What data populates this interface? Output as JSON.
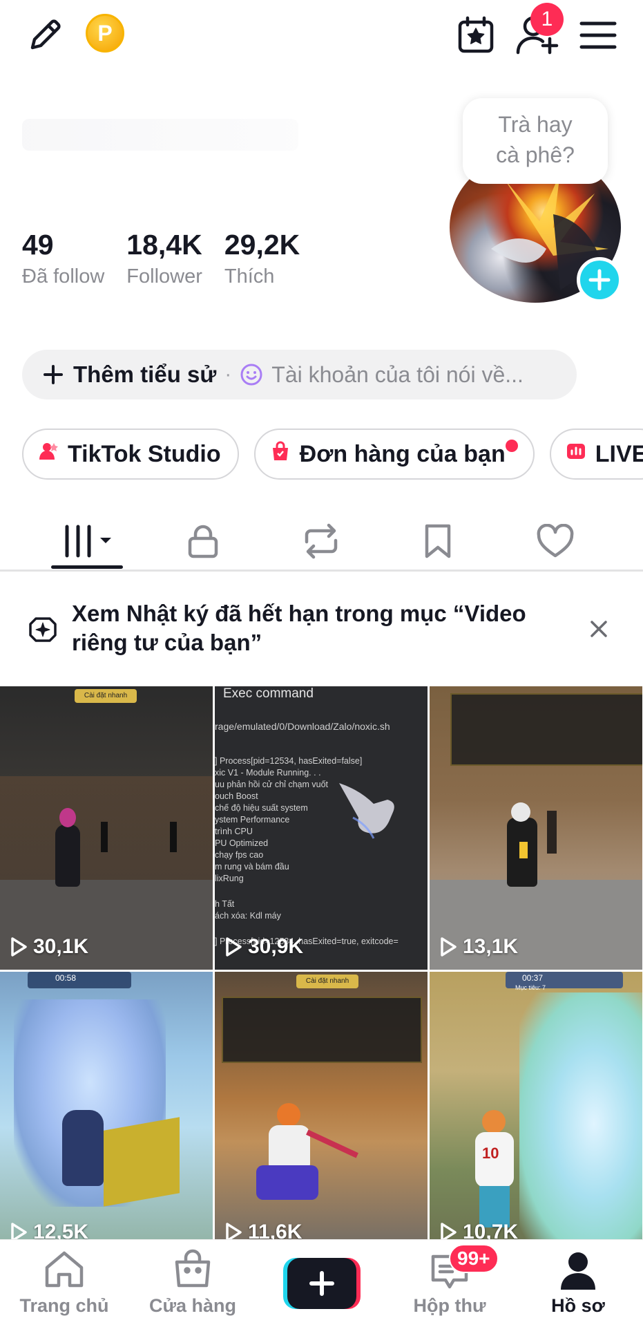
{
  "header": {
    "coin_letter": "P",
    "notification_count": "1"
  },
  "profile": {
    "bubble_text_line1": "Trà hay",
    "bubble_text_line2": "cà phê?",
    "stats": [
      {
        "value": "49",
        "label": "Đã follow"
      },
      {
        "value": "18,4K",
        "label": "Follower"
      },
      {
        "value": "29,2K",
        "label": "Thích"
      }
    ],
    "bio_add_label": "Thêm tiểu sử",
    "bio_separator": "·",
    "bio_placeholder": "Tài khoản của tôi nói về..."
  },
  "chips": [
    {
      "label": "TikTok Studio"
    },
    {
      "label": "Đơn hàng của bạn"
    },
    {
      "label": "LIVE"
    }
  ],
  "tabs": [
    {
      "icon": "grid-icon"
    },
    {
      "icon": "lock-icon"
    },
    {
      "icon": "repost-icon"
    },
    {
      "icon": "bookmark-icon"
    },
    {
      "icon": "heart-icon"
    }
  ],
  "notice": {
    "text": "Xem Nhật ký đã hết hạn trong mục “Video riêng tư của bạn”"
  },
  "videos": [
    {
      "views": "30,1K"
    },
    {
      "views": "30,9K"
    },
    {
      "views": "13,1K"
    },
    {
      "views": "12,5K"
    },
    {
      "views": "11,6K"
    },
    {
      "views": "10,7K"
    }
  ],
  "tile_texts": {
    "exec_title": "Exec command",
    "exec_path": "rage/emulated/0/Download/Zalo/noxic.sh",
    "exec_lines": [
      "] Process[pid=12534, hasExited=false]",
      "xic V1 - Module Running. . .",
      "uu phản hồi cử chỉ chạm vuốt",
      "ouch Boost",
      "chế độ hiệu suất system",
      "ystem Performance",
      "trình CPU",
      "PU Optimized",
      "chạy fps cao",
      "m rung và bám đầu",
      "lixRung",
      "h Tất",
      "ách xóa: Kdl máy",
      "] Process[pid=12534, hasExited=true, exitcode="
    ],
    "hud_btn": "Cài đặt nhanh",
    "timer1": "00:58",
    "timer2": "00:37",
    "score_small": "Mục tiêu: 7"
  },
  "bottom_nav": {
    "home": "Trang chủ",
    "shop": "Cửa hàng",
    "inbox": "Hộp thư",
    "inbox_badge": "99+",
    "profile": "Hồ sơ"
  },
  "colors": {
    "brand_red": "#fe2c55",
    "brand_cyan": "#20d5ec",
    "text_primary": "#161823",
    "text_secondary": "#8a8b91"
  }
}
